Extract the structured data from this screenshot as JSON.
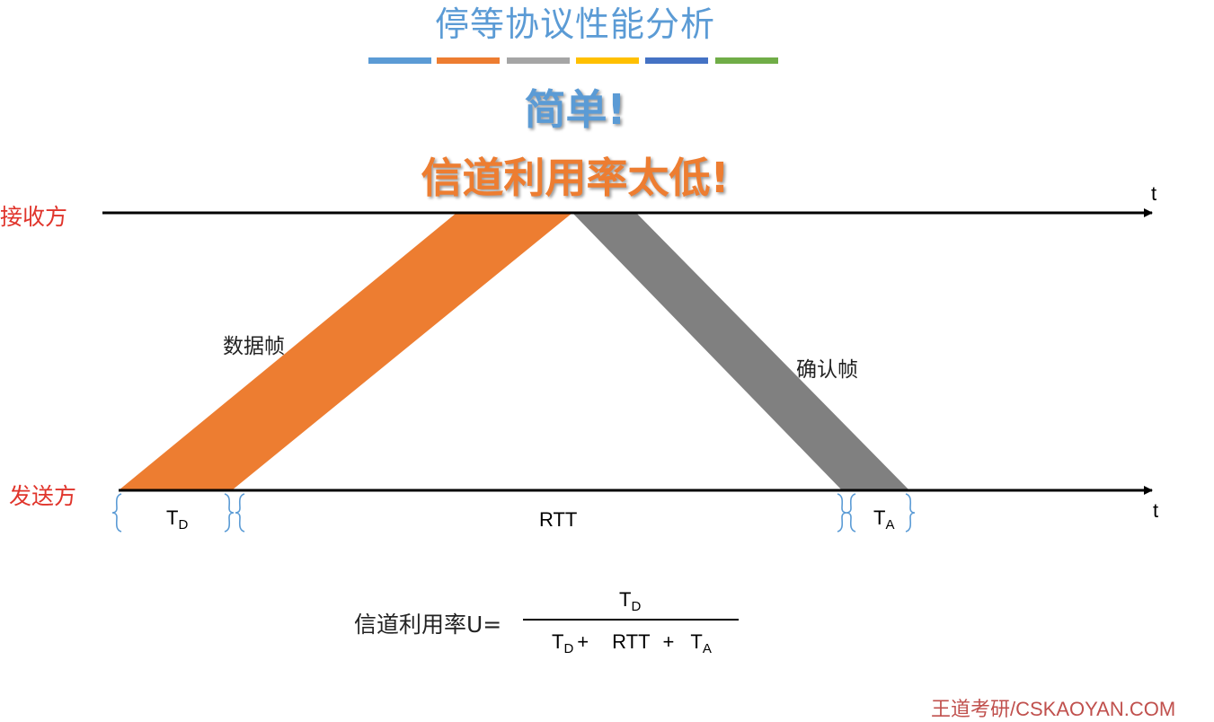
{
  "title": "停等协议性能分析",
  "color_strip": [
    "#5b9bd5",
    "#ed7d31",
    "#a5a5a5",
    "#ffc000",
    "#4472c4",
    "#70ad47"
  ],
  "simple_text": "简单!",
  "low_util_text": "信道利用率太低!",
  "receiver": {
    "label": "接收方",
    "axis_label": "t"
  },
  "sender": {
    "label": "发送方",
    "axis_label": "t"
  },
  "data_frame": {
    "label": "数据帧",
    "color": "#ed7d31"
  },
  "ack_frame": {
    "label": "确认帧",
    "color": "#808080"
  },
  "segments": {
    "td": {
      "main": "T",
      "sub": "D"
    },
    "rtt": "RTT",
    "ta": {
      "main": "T",
      "sub": "A"
    }
  },
  "brace_color": "#5b9bd5",
  "formula": {
    "label": "信道利用率U=",
    "numerator": {
      "main": "T",
      "sub": "D"
    },
    "denominator": {
      "td_main": "T",
      "td_sub": "D",
      "plus1": "+",
      "rtt": "RTT",
      "plus2": "+",
      "ta_main": "T",
      "ta_sub": "A"
    }
  },
  "brand": "王道考研/CSKAOYAN.COM"
}
